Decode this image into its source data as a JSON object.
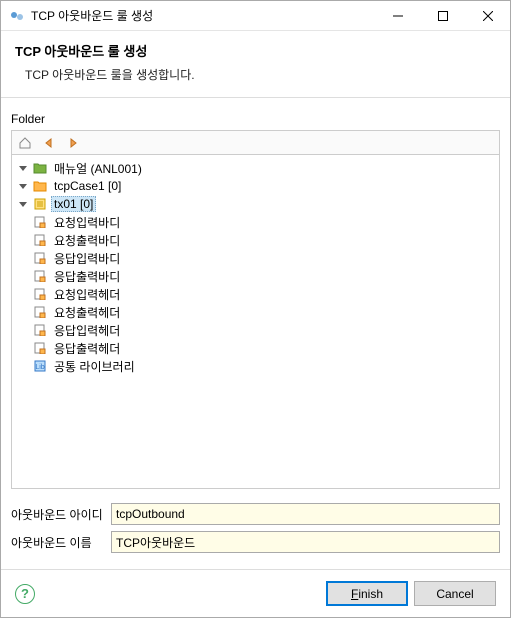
{
  "titlebar": {
    "title": "TCP 아웃바운드 룰 생성"
  },
  "header": {
    "title": "TCP 아웃바운드 룰 생성",
    "description": "TCP 아웃바운드 룰을 생성합니다."
  },
  "folder_label": "Folder",
  "tree": {
    "root": {
      "label": "매뉴얼 (ANL001)"
    },
    "tcpCase": {
      "label": "tcpCase1 [0]"
    },
    "tx01": {
      "label": "tx01 [0]"
    },
    "tx_children": [
      "요청입력바디",
      "요청출력바디",
      "응답입력바디",
      "응답출력바디"
    ],
    "case_children": [
      "요청입력헤더",
      "요청출력헤더",
      "응답입력헤더",
      "응답출력헤더"
    ],
    "common_lib": "공통 라이브러리"
  },
  "form": {
    "id_label": "아웃바운드 아이디",
    "id_value": "tcpOutbound",
    "name_label": "아웃바운드 이름",
    "name_value": "TCP아웃바운드"
  },
  "footer": {
    "finish_prefix": "F",
    "finish_rest": "inish",
    "cancel": "Cancel"
  }
}
